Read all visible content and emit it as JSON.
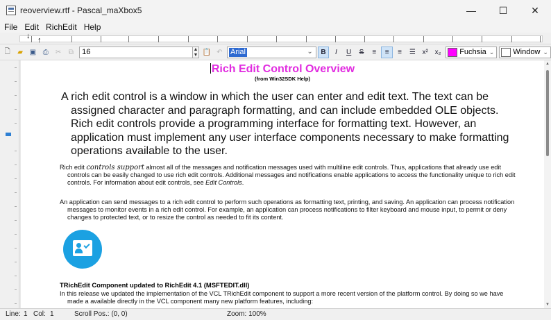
{
  "window": {
    "title": "reoverview.rtf - Pascal_maXbox5",
    "icon": "app-document-icon",
    "controls": {
      "minimize": "—",
      "maximize": "☐",
      "close": "✕"
    }
  },
  "menu": [
    "File",
    "Edit",
    "RichEdit",
    "Help"
  ],
  "toolbar": {
    "font_size": "16",
    "font_name": "Arial",
    "bold": "B",
    "italic": "I",
    "underline": "U",
    "strike": "S",
    "superscript": "x²",
    "subscript": "x₂",
    "font_color_name": "Fuchsia",
    "font_color": "#ff00ff",
    "back_color_name": "Window",
    "back_color": "#ffffff"
  },
  "document": {
    "title": "Rich Edit Control Overview",
    "subtitle": "(from Win32SDK Help)",
    "para1": "A rich edit control is a window in which the user can enter and edit text. The text can be assigned character and paragraph formatting, and can include embedded OLE objects. Rich edit controls provide a programming interface for formatting text. However, an application must implement any user interface components necessary to make formatting operations available to the user.",
    "para2_start": "Rich edit ",
    "para2_styled": "controls support",
    "para2_rest": " almost all of the messages and notification messages used with multiline edit controls. Thus, applications that already use edit controls can be easily changed to use rich edit controls. Additional messages and notifications enable applications to access the functionality unique to rich edit controls. For information about edit controls, see ",
    "para2_link": "Edit Controls",
    "para2_end": ".",
    "para3": "An application can send messages to a rich edit control to perform such operations as formatting text, printing, and saving. An application can process notification messages to monitor events in a rich edit control. For example, an application can process notifications to filter keyboard and mouse input, to permit or deny changes to protected text, or to resize the control as needed to fit its content.",
    "section_heading": "TRichEdit Component updated to RichEdit 4.1 (MSFTEDIT.dll)",
    "para4": "In this release we updated the implementation of the VCL TRichEdit component to support a more recent version of the platform control. By doing so we have made a available directly in the VCL component many new platform features, including:",
    "logo_color": "#1ba1e2",
    "title_color": "#e12be0"
  },
  "status": {
    "line_label": "Line:",
    "line_value": "1",
    "col_label": "Col:",
    "col_value": "1",
    "scroll": "Scroll Pos.: (0, 0)",
    "zoom": "Zoom: 100%"
  }
}
